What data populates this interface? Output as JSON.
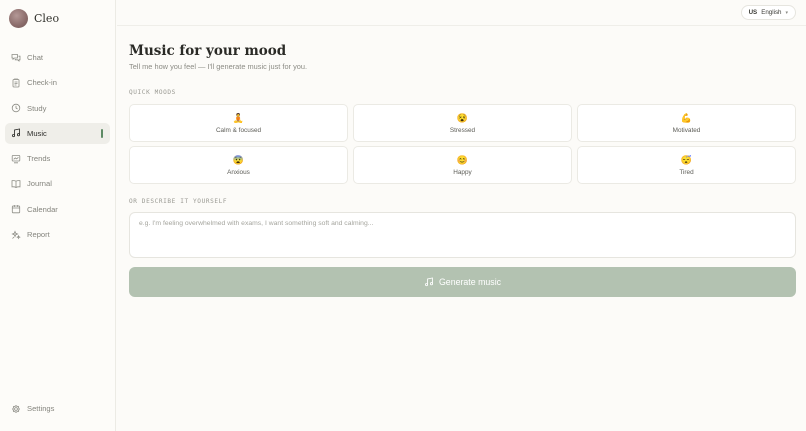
{
  "brand": {
    "name": "Cleo",
    "avatar_icon": "avatar"
  },
  "sidebar": {
    "items": [
      {
        "label": "Chat",
        "icon": "chat-bubbles-icon"
      },
      {
        "label": "Check-in",
        "icon": "clipboard-icon"
      },
      {
        "label": "Study",
        "icon": "clock-icon"
      },
      {
        "label": "Music",
        "icon": "music-note-icon",
        "active": true
      },
      {
        "label": "Trends",
        "icon": "trend-chart-icon"
      },
      {
        "label": "Journal",
        "icon": "book-icon"
      },
      {
        "label": "Calendar",
        "icon": "calendar-icon"
      },
      {
        "label": "Report",
        "icon": "sparkle-icon"
      }
    ],
    "settings": {
      "label": "Settings",
      "icon": "gear-icon"
    }
  },
  "language": {
    "code": "US",
    "label": "English"
  },
  "main": {
    "title": "Music for your mood",
    "subtitle": "Tell me how you feel — I'll generate music just for you.",
    "quick_moods_label": "QUICK MOODS",
    "moods": [
      {
        "emoji": "🧘",
        "label": "Calm & focused"
      },
      {
        "emoji": "😵",
        "label": "Stressed"
      },
      {
        "emoji": "💪",
        "label": "Motivated"
      },
      {
        "emoji": "😨",
        "label": "Anxious"
      },
      {
        "emoji": "😊",
        "label": "Happy"
      },
      {
        "emoji": "😴",
        "label": "Tired"
      }
    ],
    "describe_label": "OR DESCRIBE IT YOURSELF",
    "describe_placeholder": "e.g. I'm feeling overwhelmed with exams, I want something soft and calming...",
    "generate_label": "Generate music"
  },
  "colors": {
    "accent": "#5d8a64",
    "button": "#b3c2b1"
  }
}
